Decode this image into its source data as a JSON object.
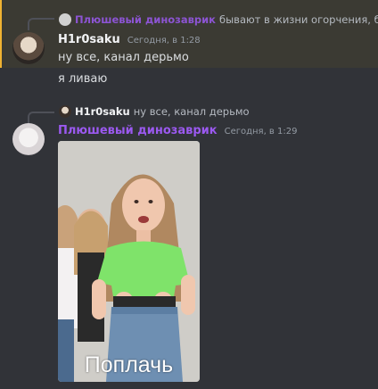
{
  "messages": [
    {
      "reply": {
        "author": "Плюшевый динозаврик",
        "text": "бывают в жизни огорчения, бро"
      },
      "author": "H1r0saku",
      "author_color": "#f2f3f5",
      "timestamp": "Сегодня, в 1:28",
      "lines": [
        "ну все, канал дерьмо",
        "я ливаю"
      ],
      "highlighted": true
    },
    {
      "reply": {
        "author": "H1r0saku",
        "text": "ну все, канал дерьмо"
      },
      "author": "Плюшевый динозаврик",
      "author_color": "#9b59f0",
      "timestamp": "Сегодня, в 1:29",
      "attachment": {
        "type": "video",
        "caption": "Поплачь"
      }
    }
  ],
  "colors": {
    "background": "#313338",
    "highlight": "#3b3a33",
    "mention_bar": "#f0b232",
    "muted": "#949ba4"
  }
}
